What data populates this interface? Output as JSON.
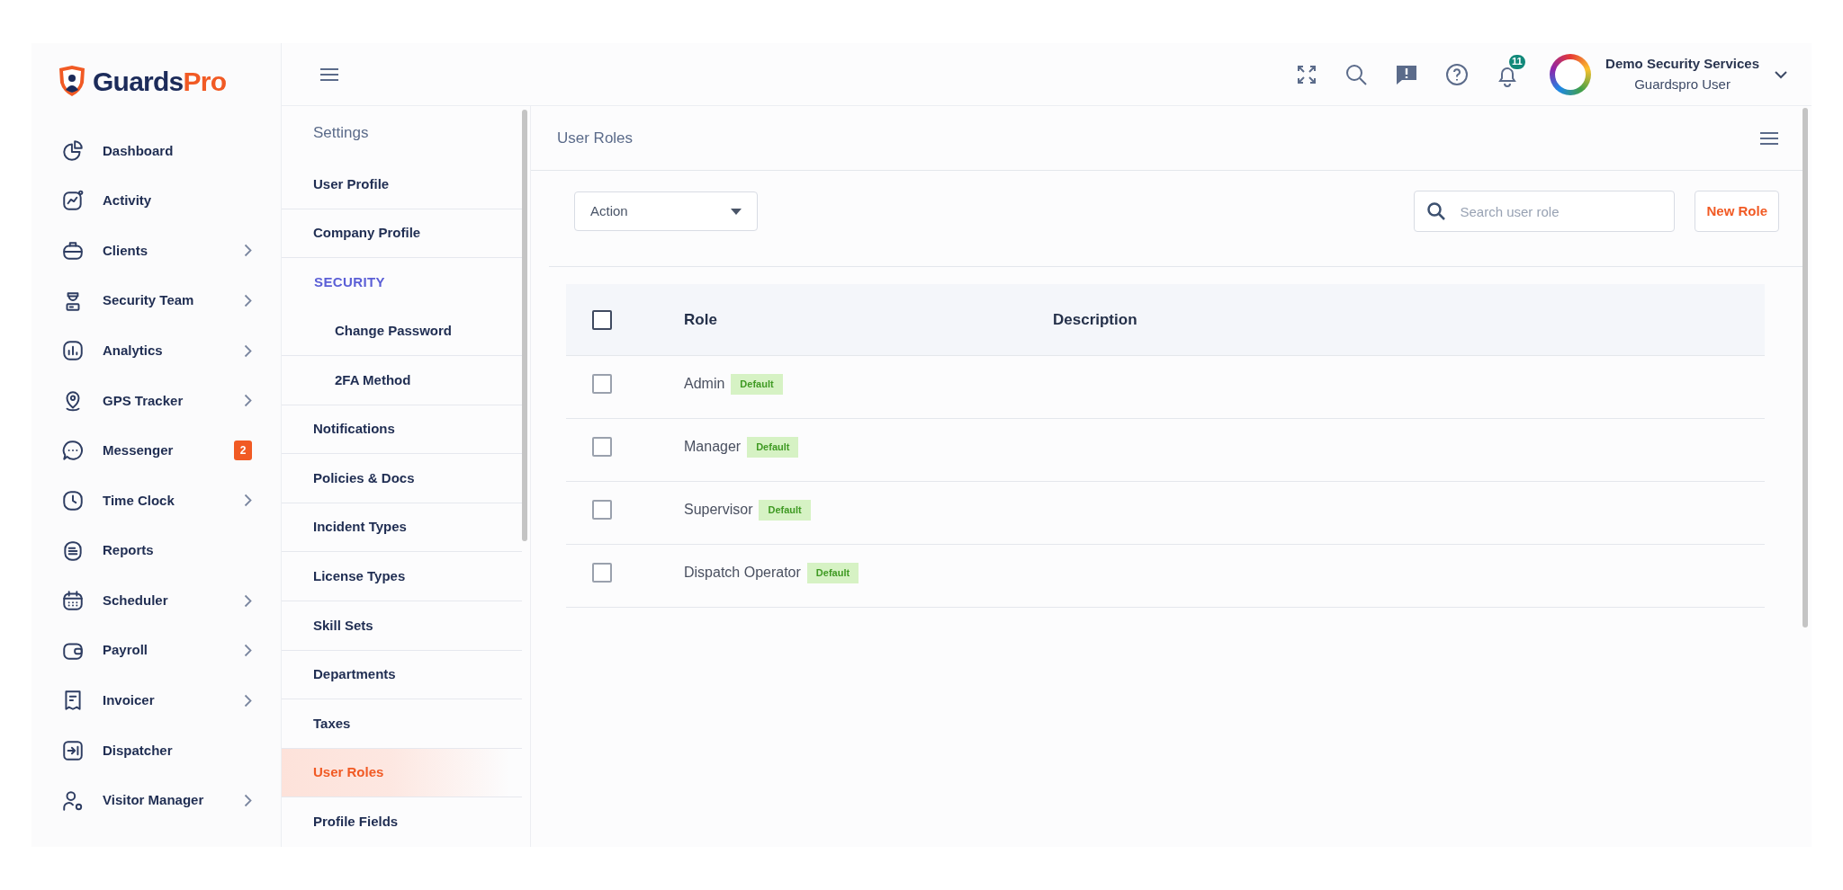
{
  "logo": {
    "primary": "Guards",
    "accent": "Pro"
  },
  "sidebar": {
    "items": [
      {
        "label": "Dashboard",
        "expandable": false
      },
      {
        "label": "Activity",
        "expandable": false
      },
      {
        "label": "Clients",
        "expandable": true
      },
      {
        "label": "Security Team",
        "expandable": true
      },
      {
        "label": "Analytics",
        "expandable": true
      },
      {
        "label": "GPS Tracker",
        "expandable": true
      },
      {
        "label": "Messenger",
        "expandable": false,
        "badge": "2"
      },
      {
        "label": "Time Clock",
        "expandable": true
      },
      {
        "label": "Reports",
        "expandable": false
      },
      {
        "label": "Scheduler",
        "expandable": true
      },
      {
        "label": "Payroll",
        "expandable": true
      },
      {
        "label": "Invoicer",
        "expandable": true
      },
      {
        "label": "Dispatcher",
        "expandable": false
      },
      {
        "label": "Visitor Manager",
        "expandable": true
      }
    ]
  },
  "topbar": {
    "notification_count": "11",
    "user_name": "Demo Security Services",
    "user_role": "Guardspro User"
  },
  "settings": {
    "title": "Settings",
    "items": [
      {
        "kind": "item",
        "label": "User Profile",
        "selected": false
      },
      {
        "kind": "item",
        "label": "Company Profile",
        "selected": false
      },
      {
        "kind": "section",
        "label": "SECURITY"
      },
      {
        "kind": "subitem",
        "label": "Change Password",
        "selected": false
      },
      {
        "kind": "subitem",
        "label": "2FA Method",
        "selected": false
      },
      {
        "kind": "item",
        "label": "Notifications",
        "selected": false
      },
      {
        "kind": "item",
        "label": "Policies & Docs",
        "selected": false
      },
      {
        "kind": "item",
        "label": "Incident Types",
        "selected": false
      },
      {
        "kind": "item",
        "label": "License Types",
        "selected": false
      },
      {
        "kind": "item",
        "label": "Skill Sets",
        "selected": false
      },
      {
        "kind": "item",
        "label": "Departments",
        "selected": false
      },
      {
        "kind": "item",
        "label": "Taxes",
        "selected": false
      },
      {
        "kind": "item",
        "label": "User Roles",
        "selected": true
      },
      {
        "kind": "item",
        "label": "Profile Fields",
        "selected": false
      }
    ]
  },
  "main": {
    "title": "User Roles",
    "action_dropdown": {
      "label": "Action"
    },
    "search": {
      "placeholder": "Search user role"
    },
    "new_button": "New Role",
    "table": {
      "header_checked": false,
      "columns": [
        "Role",
        "Description"
      ],
      "rows": [
        {
          "role": "Admin",
          "badge": "Default",
          "checked": false
        },
        {
          "role": "Manager",
          "badge": "Default",
          "checked": false
        },
        {
          "role": "Supervisor",
          "badge": "Default",
          "checked": false
        },
        {
          "role": "Dispatch Operator",
          "badge": "Default",
          "checked": false
        }
      ]
    }
  }
}
